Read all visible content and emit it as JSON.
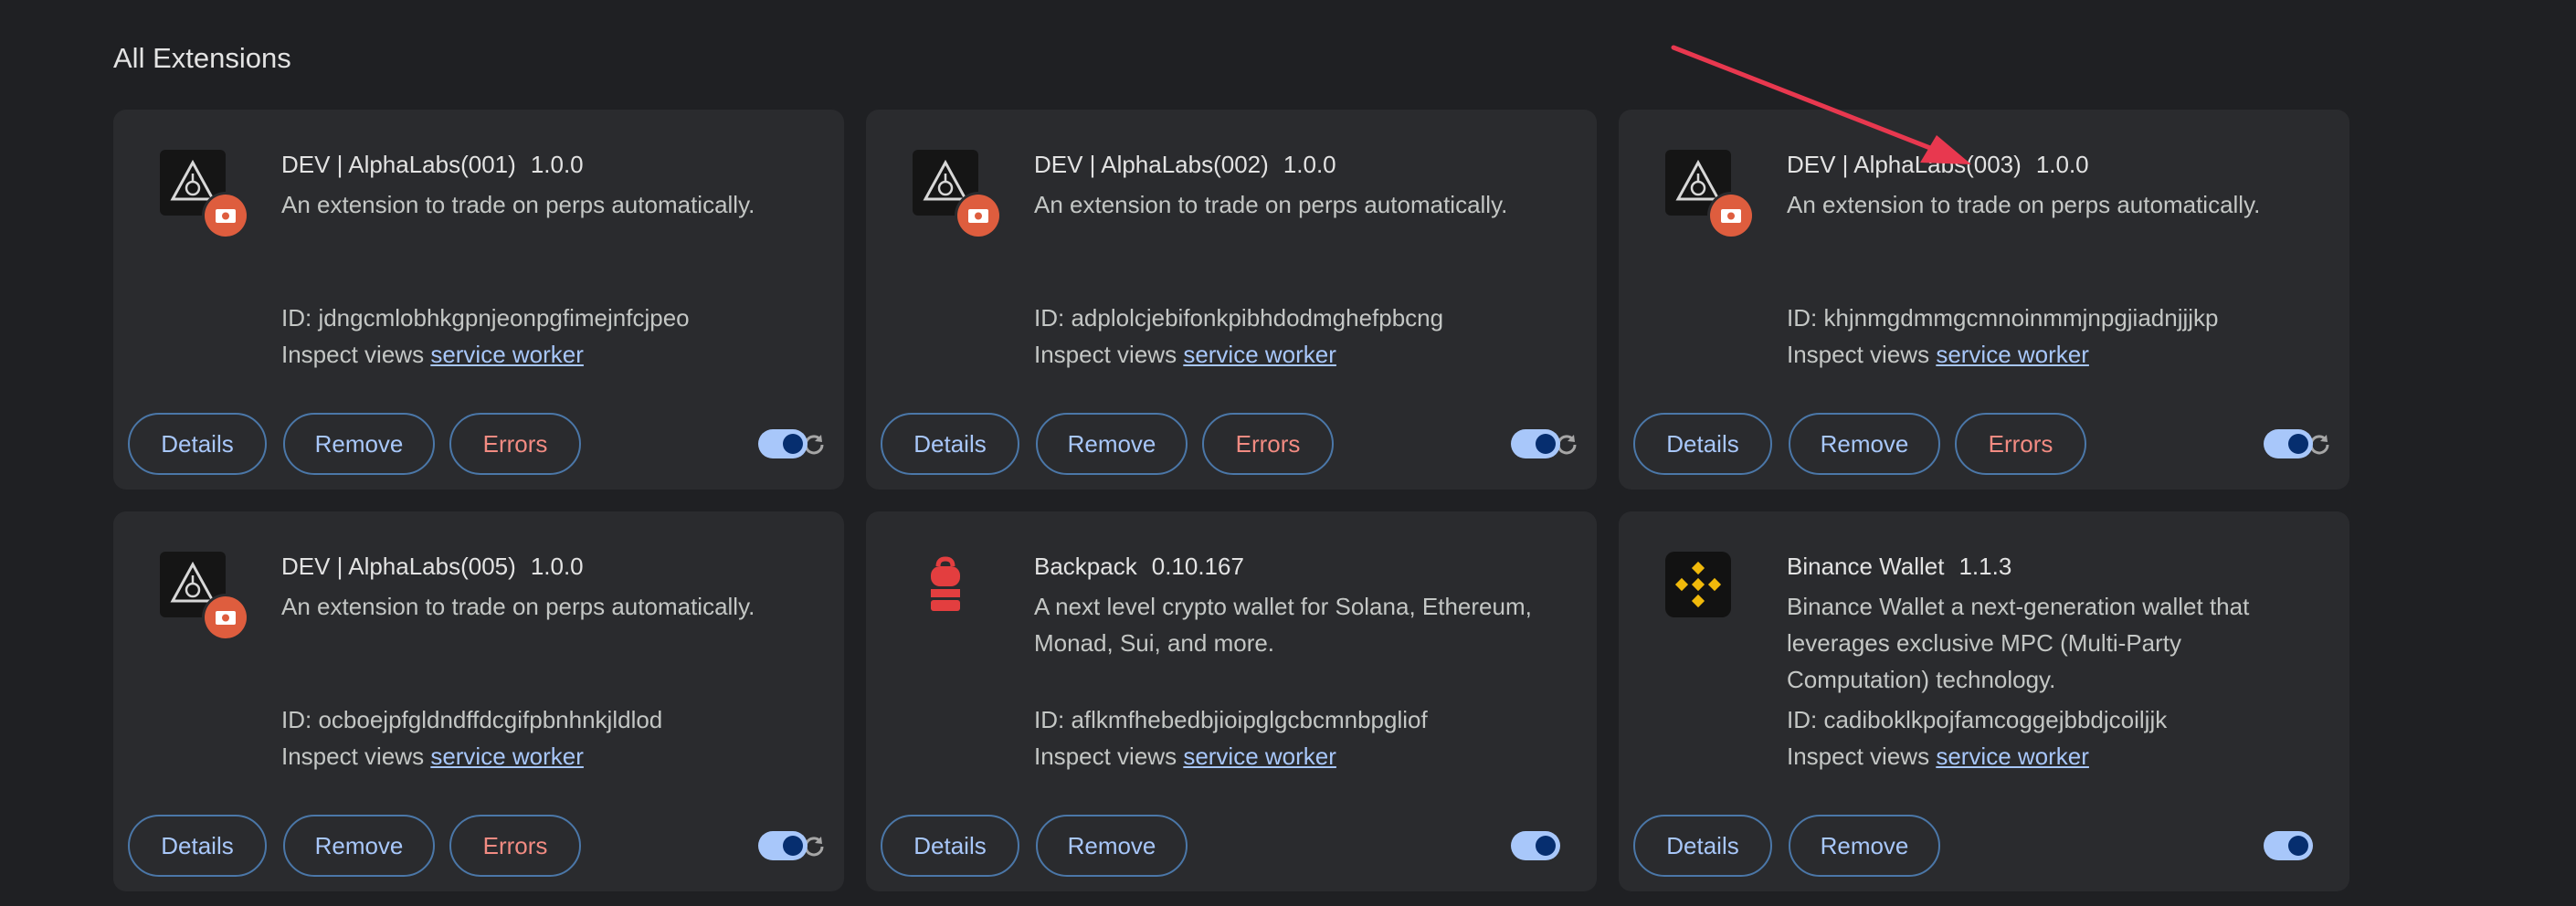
{
  "section_title": "All Extensions",
  "colors": {
    "background": "#1f2023",
    "card": "#2a2b2e",
    "link": "#a8c7fa",
    "errors": "#f28b82",
    "badge": "#de5d3e",
    "annotation_arrow": "#e8384f"
  },
  "labels": {
    "details": "Details",
    "remove": "Remove",
    "errors": "Errors",
    "inspect_views": "Inspect views",
    "service_worker": "service worker"
  },
  "extensions": [
    {
      "name": "DEV | AlphaLabs(001)",
      "version": "1.0.0",
      "description": "An extension to trade on perps automatically.",
      "id_line": "ID: jdngcmlobhkgpnjeonpgfimejnfcjpeo",
      "icon": "dev-alphalabs-icon",
      "enabled": true,
      "has_errors": true,
      "has_reload": true
    },
    {
      "name": "DEV | AlphaLabs(002)",
      "version": "1.0.0",
      "description": "An extension to trade on perps automatically.",
      "id_line": "ID: adplolcjebifonkpibhdodmghefpbcng",
      "icon": "dev-alphalabs-icon",
      "enabled": true,
      "has_errors": true,
      "has_reload": true
    },
    {
      "name": "DEV | AlphaLabs(003)",
      "version": "1.0.0",
      "description": "An extension to trade on perps automatically.",
      "id_line": "ID: khjnmgdmmgcmnoinmmjnpgjiadnjjjkp",
      "icon": "dev-alphalabs-icon",
      "enabled": true,
      "has_errors": true,
      "has_reload": true
    },
    {
      "name": "DEV | AlphaLabs(005)",
      "version": "1.0.0",
      "description": "An extension to trade on perps automatically.",
      "id_line": "ID: ocboejpfgldndffdcgifpbnhnkjldlod",
      "icon": "dev-alphalabs-icon",
      "enabled": true,
      "has_errors": true,
      "has_reload": true
    },
    {
      "name": "Backpack",
      "version": "0.10.167",
      "description": "A next level crypto wallet for Solana, Ethereum, Monad, Sui, and more.",
      "id_line": "ID: aflkmfhebedbjioipglgcbcmnbpgliof",
      "icon": "backpack-icon",
      "enabled": true,
      "has_errors": false,
      "has_reload": false
    },
    {
      "name": "Binance Wallet",
      "version": "1.1.3",
      "description": "Binance Wallet a next-generation wallet that leverages exclusive MPC (Multi-Party Computation) technology.",
      "id_line": "ID: cadiboklkpojfamcoggejbbdjcoiljjk",
      "icon": "binance-icon",
      "enabled": true,
      "has_errors": false,
      "has_reload": false
    }
  ]
}
